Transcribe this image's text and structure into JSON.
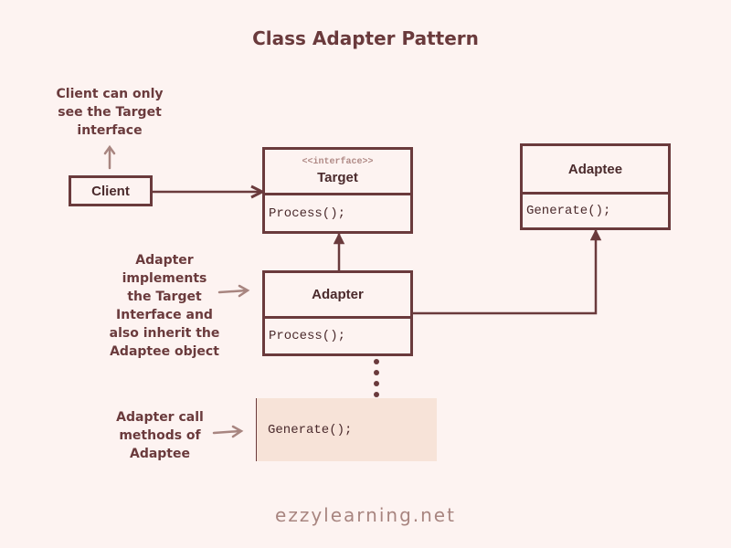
{
  "title": "Class Adapter Pattern",
  "annotations": {
    "client_note": [
      "Client can only",
      "see the Target",
      "interface"
    ],
    "adapter_note": [
      "Adapter",
      "implements",
      "the Target",
      "Interface and",
      "also inherit the",
      "Adaptee object"
    ],
    "call_note": [
      "Adapter call",
      "methods of",
      "Adaptee"
    ]
  },
  "client": {
    "label": "Client"
  },
  "target": {
    "stereotype": "<<interface>>",
    "name": "Target",
    "method": "Process();"
  },
  "adaptee": {
    "name": "Adaptee",
    "method": "Generate();"
  },
  "adapter": {
    "name": "Adapter",
    "method": "Process();"
  },
  "code_note": {
    "code": "Generate();"
  },
  "footer": "ezzylearning.net",
  "colors": {
    "stroke": "#6a3a3c",
    "background": "#fdf3f1",
    "note_fill": "#f7e3d8",
    "soft_arrow": "#a88580"
  }
}
